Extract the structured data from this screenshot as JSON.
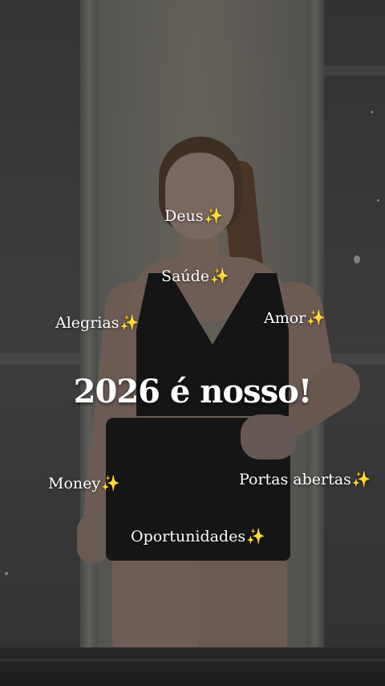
{
  "overlay": {
    "headline": "2026 é nosso!",
    "sparkle": "✨",
    "words": {
      "deus": "Deus",
      "saude": "Saúde",
      "alegrias": "Alegrias",
      "amor": "Amor",
      "money": "Money",
      "portas_abertas": "Portas abertas",
      "oportunidades": "Oportunidades"
    }
  },
  "colors": {
    "text": "#ffffff",
    "outfit": "#141414",
    "background": "#4a4a4a"
  },
  "icons": [
    "sparkles-icon"
  ]
}
